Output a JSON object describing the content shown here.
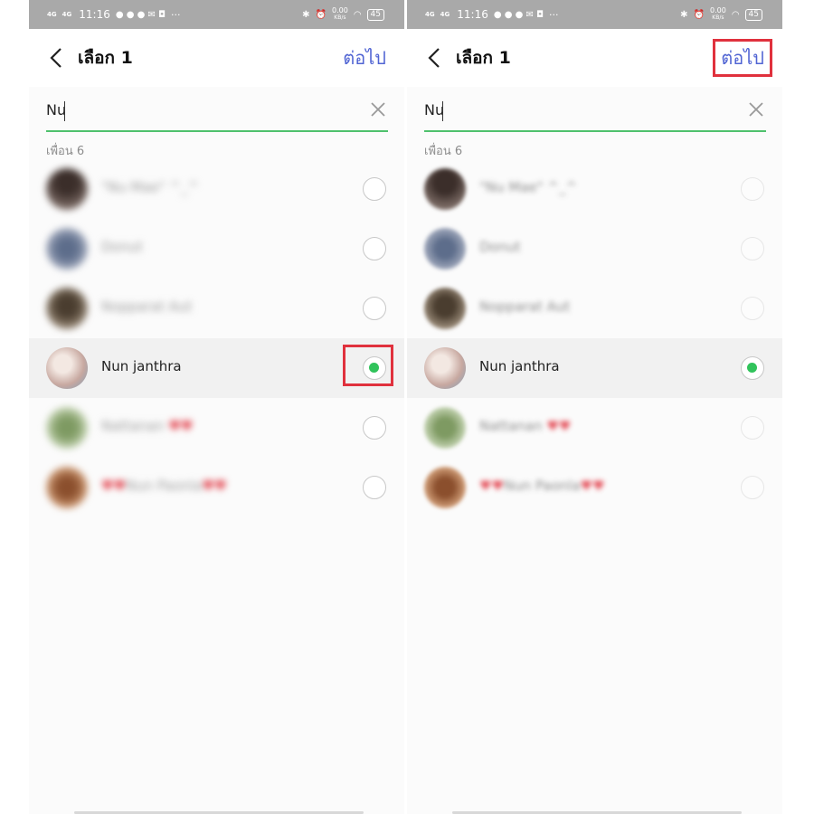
{
  "status_bar": {
    "network1": "4G",
    "network2": "4G",
    "time": "11:16",
    "more": "···",
    "speed_value": "0.00",
    "speed_unit": "KB/s",
    "battery": "45"
  },
  "header": {
    "back_icon": "chevron-left-icon",
    "title": "เลือก 1",
    "next_label": "ต่อไป"
  },
  "search": {
    "query": "Nu",
    "clear_icon": "close-icon"
  },
  "section_label": "เพื่อน 6",
  "friends": [
    {
      "name": "\"Nu Mae\" ^_^",
      "selected": false,
      "avatar_color": "#5b4a44"
    },
    {
      "name": "Donut",
      "selected": false,
      "avatar_color": "#7d8aa3"
    },
    {
      "name": "Nopparat Aut",
      "selected": false,
      "avatar_color": "#6b5c45"
    },
    {
      "name": "Nun janthra",
      "selected": true,
      "avatar_color": "#d9c6c2"
    },
    {
      "name": "Nattanan",
      "selected": false,
      "avatar_color": "#93ad7a"
    },
    {
      "name": "Nun Paonla",
      "selected": false,
      "avatar_color": "#a86c45"
    }
  ],
  "colors": {
    "accent_green": "#31c35b",
    "link_blue": "#5064d3",
    "highlight_red": "#e0313d"
  }
}
